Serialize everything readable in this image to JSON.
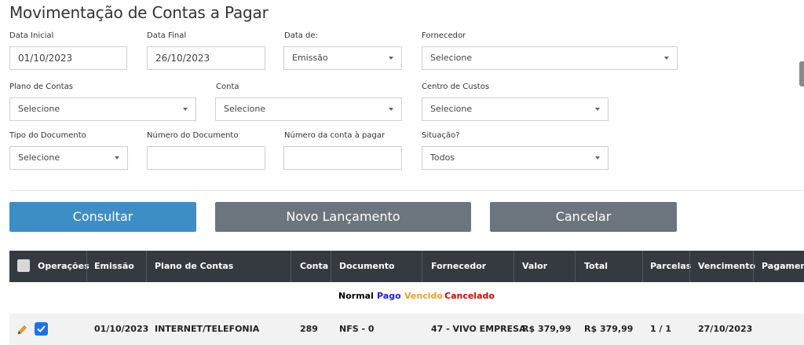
{
  "page": {
    "title": "Movimentação de Contas a Pagar"
  },
  "filters": {
    "data_inicial": {
      "label": "Data Inicial",
      "value": "01/10/2023"
    },
    "data_final": {
      "label": "Data Final",
      "value": "26/10/2023"
    },
    "data_de": {
      "label": "Data de:",
      "value": "Emissão"
    },
    "fornecedor": {
      "label": "Fornecedor",
      "value": "Selecione"
    },
    "plano_contas": {
      "label": "Plano de Contas",
      "value": "Selecione"
    },
    "conta": {
      "label": "Conta",
      "value": "Selecione"
    },
    "centro_custos": {
      "label": "Centro de Custos",
      "value": "Selecione"
    },
    "tipo_documento": {
      "label": "Tipo do Documento",
      "value": "Selecione"
    },
    "numero_documento": {
      "label": "Número do Documento",
      "value": ""
    },
    "numero_conta_pagar": {
      "label": "Número da conta à pagar",
      "value": ""
    },
    "situacao": {
      "label": "Situação?",
      "value": "Todos"
    }
  },
  "buttons": {
    "consultar": "Consultar",
    "novo_lancamento": "Novo Lançamento",
    "cancelar": "Cancelar"
  },
  "table": {
    "headers": {
      "operacoes": "Operações",
      "emissao": "Emissão",
      "plano_contas": "Plano de Contas",
      "conta": "Conta",
      "documento": "Documento",
      "fornecedor": "Fornecedor",
      "valor": "Valor",
      "total": "Total",
      "parcelas": "Parcelas",
      "vencimento": "Vencimento",
      "pagamento": "Pagamento"
    },
    "legend": {
      "normal": "Normal",
      "pago": "Pago",
      "vencido": "Vencido",
      "cancelado": "Cancelado"
    },
    "rows": [
      {
        "emissao": "01/10/2023",
        "plano_contas": "INTERNET/TELEFONIA",
        "conta": "289",
        "documento": "NFS - 0",
        "fornecedor": "47 - VIVO EMPRESA",
        "valor": "R$ 379,99",
        "total": "R$ 379,99",
        "parcelas": "1 / 1",
        "vencimento": "27/10/2023",
        "pagamento": "",
        "checked": true
      }
    ]
  },
  "colors": {
    "primary": "#3d8ec4",
    "secondary": "#6c757d",
    "header_bg": "#343a40",
    "legend_normal": "#000000",
    "legend_pago": "#1a1aff",
    "legend_vencido": "#f0a020",
    "legend_cancelado": "#e00000",
    "check": "#1a73e8"
  },
  "icons": {
    "edit": "pencil-icon",
    "select_arrow": "chevron-down-icon",
    "checkbox": "checkbox-icon"
  }
}
